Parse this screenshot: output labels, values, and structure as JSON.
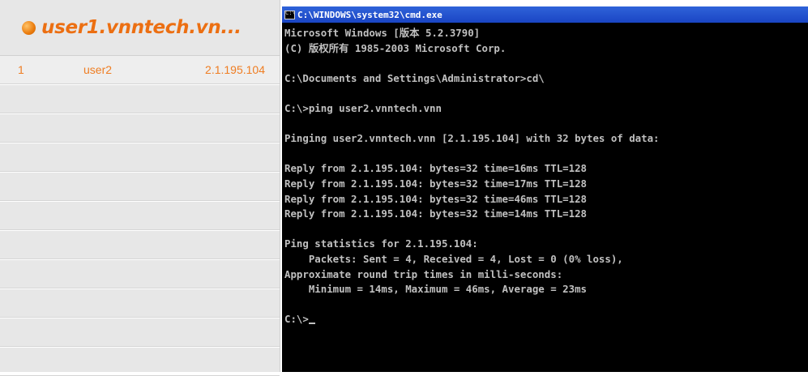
{
  "left_panel": {
    "title": "user1.vnntech.vn...",
    "rows": [
      {
        "index": "1",
        "user": "user2",
        "ip": "2.1.195.104"
      }
    ],
    "empty_row_count": 10
  },
  "console": {
    "title": "C:\\WINDOWS\\system32\\cmd.exe",
    "lines": [
      "Microsoft Windows [版本 5.2.3790]",
      "(C) 版权所有 1985-2003 Microsoft Corp.",
      "",
      "C:\\Documents and Settings\\Administrator>cd\\",
      "",
      "C:\\>ping user2.vnntech.vnn",
      "",
      "Pinging user2.vnntech.vnn [2.1.195.104] with 32 bytes of data:",
      "",
      "Reply from 2.1.195.104: bytes=32 time=16ms TTL=128",
      "Reply from 2.1.195.104: bytes=32 time=17ms TTL=128",
      "Reply from 2.1.195.104: bytes=32 time=46ms TTL=128",
      "Reply from 2.1.195.104: bytes=32 time=14ms TTL=128",
      "",
      "Ping statistics for 2.1.195.104:",
      "    Packets: Sent = 4, Received = 4, Lost = 0 (0% loss),",
      "Approximate round trip times in milli-seconds:",
      "    Minimum = 14ms, Maximum = 46ms, Average = 23ms",
      "",
      "C:\\>"
    ]
  },
  "colors": {
    "accent": "#ec6f12",
    "console_bg": "#000000",
    "console_text": "#c0c0c0",
    "titlebar": "#1a45c4"
  }
}
